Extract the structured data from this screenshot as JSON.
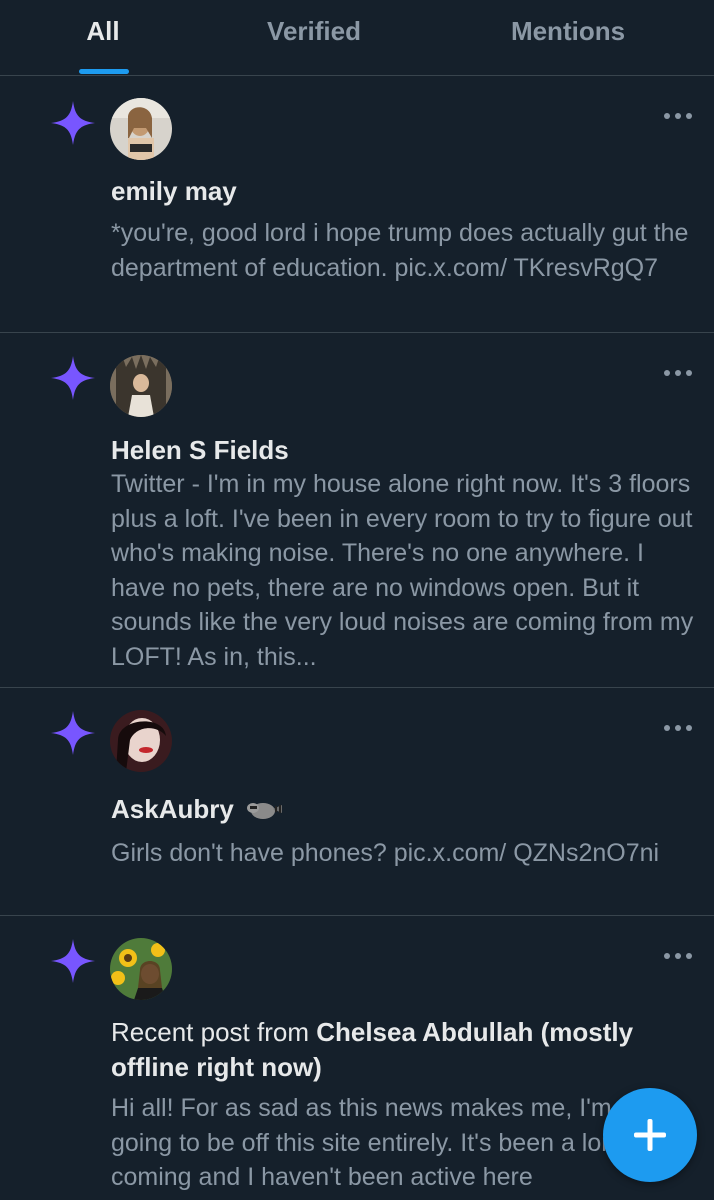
{
  "tabs": [
    {
      "label": "All",
      "active": true
    },
    {
      "label": "Verified",
      "active": false
    },
    {
      "label": "Mentions",
      "active": false
    }
  ],
  "notifications": [
    {
      "icon": "sparkle-icon",
      "name": "emily may",
      "text": "*you're, good lord i hope trump does actually gut the department of education. pic.x.com/ TKresvRgQ7"
    },
    {
      "icon": "sparkle-icon",
      "name": "Helen S Fields",
      "text": "Twitter - I'm in my house alone right now. It's 3 floors plus a loft. I've been in every room to try to figure out who's making noise. There's no one anywhere. I have no pets, there are no windows open. But it sounds like the very loud noises are coming from my LOFT! As in, this..."
    },
    {
      "icon": "sparkle-icon",
      "name": "AskAubry",
      "name_emoji": "raccoon-icon",
      "text": "Girls don't have phones? pic.x.com/ QZNs2nO7ni"
    },
    {
      "icon": "sparkle-icon",
      "prefix": "Recent post from ",
      "name": "Chelsea Abdullah (mostly offline right now)",
      "text": "Hi all! For as sad as this news makes me, I'm soon going to be off this site entirely. It's been a long time coming and I haven't been active here"
    }
  ],
  "fab": {
    "icon": "plus-icon"
  },
  "colors": {
    "background": "#15202b",
    "accent": "#1d9bf0",
    "sparkle": "#7856ff",
    "muted_text": "#8b98a5",
    "divider": "#38444d"
  }
}
